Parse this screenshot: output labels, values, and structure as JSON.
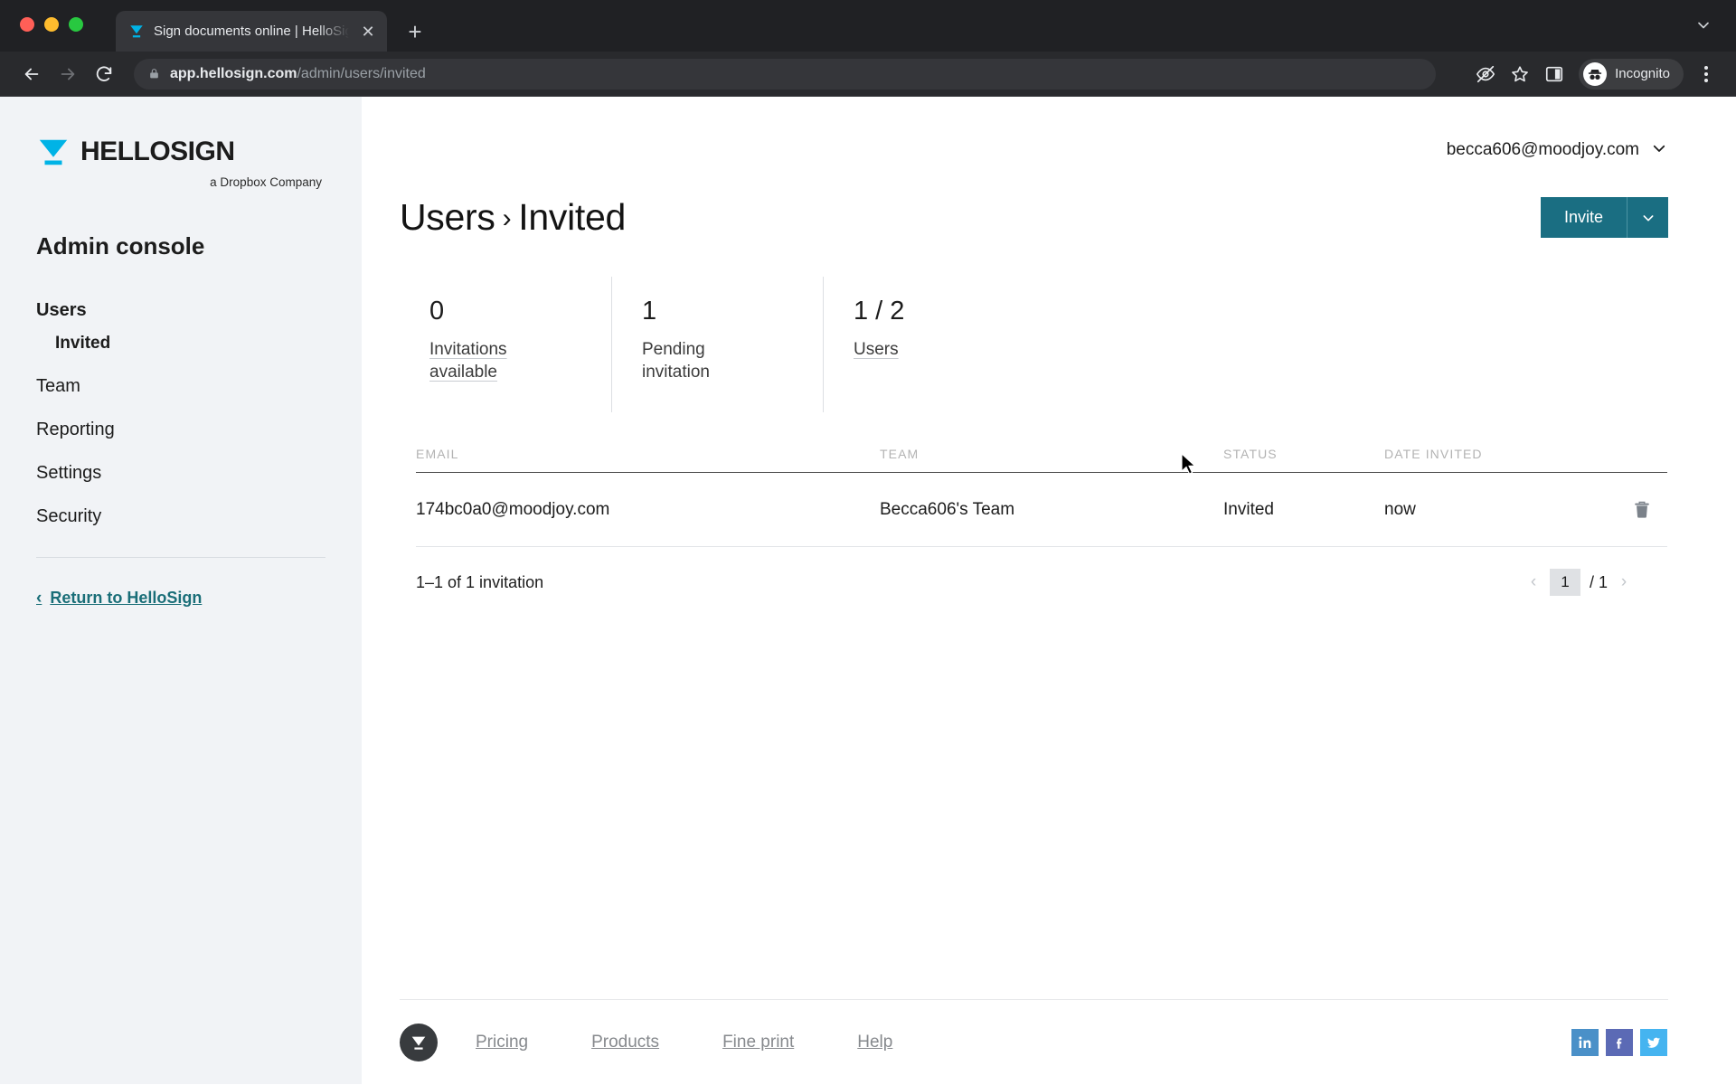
{
  "browser": {
    "tab": {
      "title": "Sign documents online | HelloSign",
      "favicon_name": "hellosign-favicon",
      "close_label": "✕",
      "new_tab_label": "+"
    },
    "omnibox": {
      "url_bold": "app.hellosign.com",
      "url_path": "/admin/users/invited"
    },
    "profile": {
      "label": "Incognito"
    }
  },
  "sidebar": {
    "logo": {
      "word": "HELLOSIGN",
      "subtitle": "a Dropbox Company"
    },
    "heading": "Admin console",
    "items": [
      {
        "label": "Users",
        "type": "parent",
        "active": true
      },
      {
        "label": "Invited",
        "type": "child",
        "active": true
      },
      {
        "label": "Team",
        "type": "parent",
        "active": false
      },
      {
        "label": "Reporting",
        "type": "parent",
        "active": false
      },
      {
        "label": "Settings",
        "type": "parent",
        "active": false
      },
      {
        "label": "Security",
        "type": "parent",
        "active": false
      }
    ],
    "return_link": "Return to HelloSign"
  },
  "header": {
    "account_email": "becca606@moodjoy.com"
  },
  "main": {
    "breadcrumb_parent": "Users",
    "breadcrumb_separator": "›",
    "breadcrumb_current": "Invited",
    "invite_button": "Invite"
  },
  "stats": [
    {
      "value": "0",
      "label": "Invitations available",
      "hinted": true
    },
    {
      "value": "1",
      "label": "Pending invitation",
      "hinted": false
    },
    {
      "value": "1 / 2",
      "label": "Users",
      "hinted": true
    }
  ],
  "table": {
    "columns": [
      "EMAIL",
      "TEAM",
      "STATUS",
      "DATE INVITED"
    ],
    "rows": [
      {
        "email": "174bc0a0@moodjoy.com",
        "team": "Becca606's Team",
        "status": "Invited",
        "date_invited": "now",
        "action_icon": "trash-icon"
      }
    ],
    "count_text": "1–1 of 1 invitation",
    "pagination": {
      "prev": "‹",
      "current_page": "1",
      "total_pages": "/ 1",
      "next": "›"
    }
  },
  "footer": {
    "links": [
      "Pricing",
      "Products",
      "Fine print",
      "Help"
    ],
    "socials": [
      {
        "name": "linkedin-icon",
        "color": "#4a90c8"
      },
      {
        "name": "facebook-icon",
        "color": "#5b6ab5"
      },
      {
        "name": "twitter-icon",
        "color": "#45b4f0"
      }
    ]
  },
  "colors": {
    "brand_teal": "#1a6e82",
    "brand_cyan": "#00b3e6",
    "sidebar_bg": "#f1f3f6",
    "link_teal": "#1a6e78"
  }
}
